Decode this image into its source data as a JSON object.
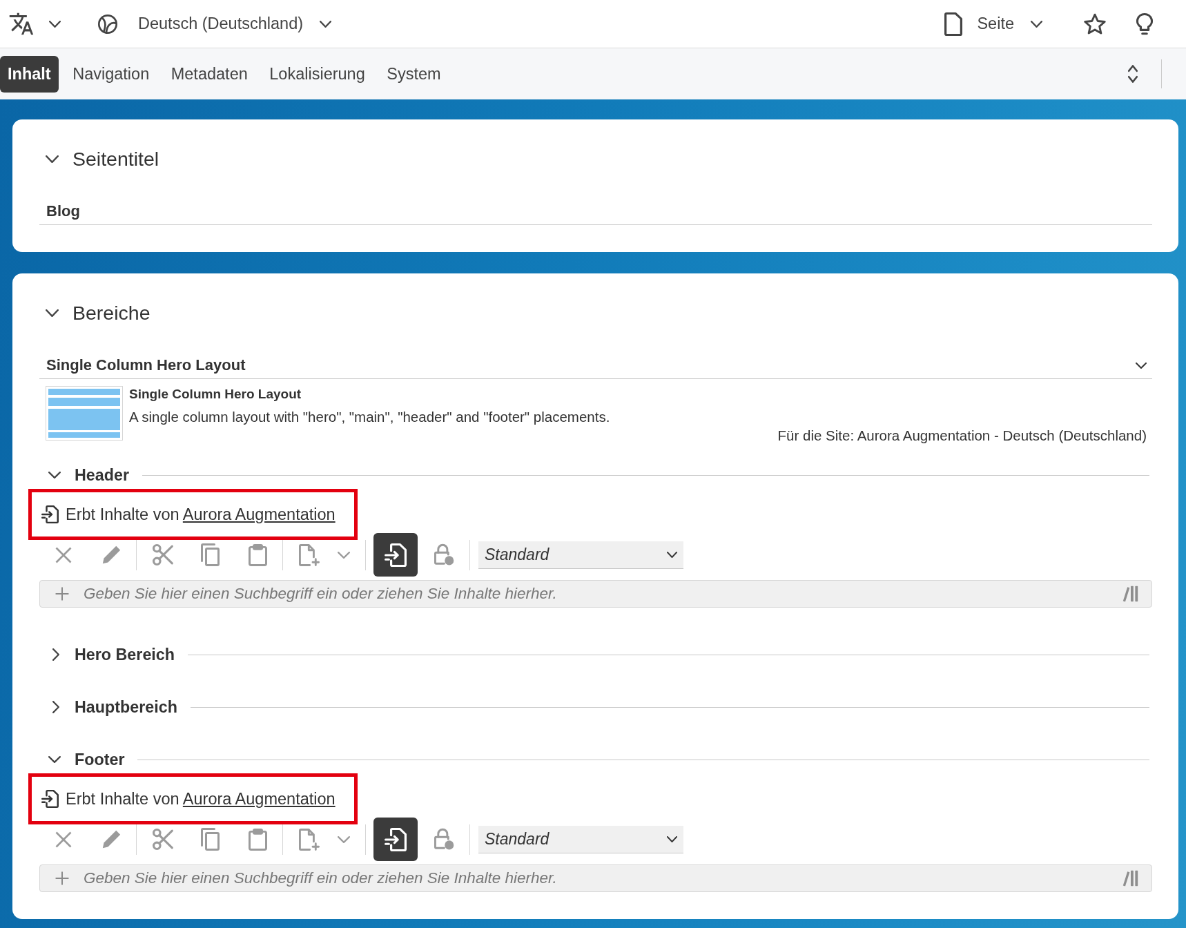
{
  "top_bar": {
    "language": "Deutsch (Deutschland)",
    "page_menu": "Seite"
  },
  "tabs": [
    {
      "label": "Inhalt",
      "selected": true
    },
    {
      "label": "Navigation",
      "selected": false
    },
    {
      "label": "Metadaten",
      "selected": false
    },
    {
      "label": "Lokalisierung",
      "selected": false
    },
    {
      "label": "System",
      "selected": false
    }
  ],
  "page_title_card": {
    "title": "Seitentitel",
    "expanded": true,
    "value": "Blog"
  },
  "regions_card": {
    "title": "Bereiche",
    "expanded": true,
    "layout_select": "Single Column Hero Layout",
    "layout_info": {
      "name": "Single Column Hero Layout",
      "description": "A single column layout with \"hero\", \"main\", \"header\" and \"footer\" placements.",
      "site_note": "Für die Site: Aurora Augmentation - Deutsch (Deutschland)"
    },
    "placements": [
      {
        "title": "Header",
        "expanded": true,
        "inherit_notice": {
          "text": "Erbt Inhalte von",
          "link": "Aurora Augmentation",
          "highlighted": true
        },
        "toolbar": {
          "disabled": true,
          "inherit_on": true
        },
        "style": "Standard",
        "search_placeholder": "Geben Sie hier einen Suchbegriff ein oder ziehen Sie Inhalte hierher."
      },
      {
        "title": "Hero Bereich",
        "expanded": false
      },
      {
        "title": "Hauptbereich",
        "expanded": false
      },
      {
        "title": "Footer",
        "expanded": true,
        "inherit_notice": {
          "text": "Erbt Inhalte von",
          "link": "Aurora Augmentation",
          "highlighted": true
        },
        "toolbar": {
          "disabled": true,
          "inherit_on": true
        },
        "style": "Standard",
        "search_placeholder": "Geben Sie hier einen Suchbegriff ein oder ziehen Sie Inhalte hierher."
      }
    ]
  }
}
